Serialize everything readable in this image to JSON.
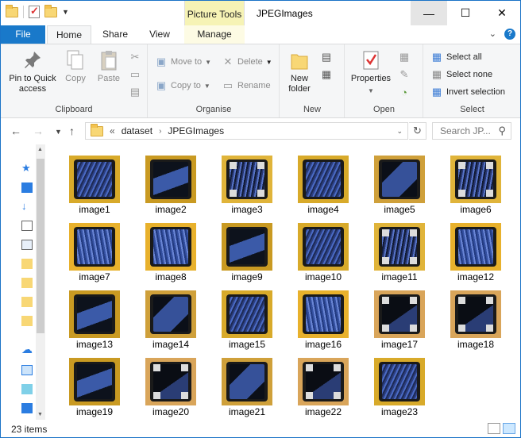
{
  "window": {
    "title": "JPEGImages",
    "context_tab": "Picture Tools",
    "controls": {
      "minimize": "—",
      "maximize": "☐",
      "close": "✕"
    }
  },
  "tabs": [
    {
      "label": "File"
    },
    {
      "label": "Home"
    },
    {
      "label": "Share"
    },
    {
      "label": "View"
    },
    {
      "label": "Manage"
    }
  ],
  "ribbon": {
    "clipboard": {
      "label": "Clipboard",
      "pin": "Pin to Quick access",
      "copy": "Copy",
      "paste": "Paste"
    },
    "organise": {
      "label": "Organise",
      "move_to": "Move to",
      "copy_to": "Copy to",
      "delete": "Delete",
      "rename": "Rename"
    },
    "new": {
      "label": "New",
      "new_folder": "New folder"
    },
    "open": {
      "label": "Open",
      "properties": "Properties"
    },
    "select": {
      "label": "Select",
      "select_all": "Select all",
      "select_none": "Select none",
      "invert": "Invert selection"
    }
  },
  "address": {
    "overflow": "«",
    "segments": [
      "dataset",
      "JPEGImages"
    ],
    "search_placeholder": "Search JP..."
  },
  "files": [
    {
      "name": "image1",
      "variant": 0
    },
    {
      "name": "image2",
      "variant": 1
    },
    {
      "name": "image3",
      "variant": 2
    },
    {
      "name": "image4",
      "variant": 0
    },
    {
      "name": "image5",
      "variant": 3
    },
    {
      "name": "image6",
      "variant": 2
    },
    {
      "name": "image7",
      "variant": 4
    },
    {
      "name": "image8",
      "variant": 4
    },
    {
      "name": "image9",
      "variant": 1
    },
    {
      "name": "image10",
      "variant": 0
    },
    {
      "name": "image11",
      "variant": 2
    },
    {
      "name": "image12",
      "variant": 4
    },
    {
      "name": "image13",
      "variant": 1
    },
    {
      "name": "image14",
      "variant": 3
    },
    {
      "name": "image15",
      "variant": 0
    },
    {
      "name": "image16",
      "variant": 4
    },
    {
      "name": "image17",
      "variant": 5
    },
    {
      "name": "image18",
      "variant": 5
    },
    {
      "name": "image19",
      "variant": 1
    },
    {
      "name": "image20",
      "variant": 5
    },
    {
      "name": "image21",
      "variant": 3
    },
    {
      "name": "image22",
      "variant": 5
    },
    {
      "name": "image23",
      "variant": 0
    }
  ],
  "status": {
    "item_count": "23 items"
  },
  "colors": {
    "accent": "#1979ca",
    "board": "#d8aa2a",
    "chip_blue": "#3a58a8",
    "chip_dark": "#0f1420"
  }
}
